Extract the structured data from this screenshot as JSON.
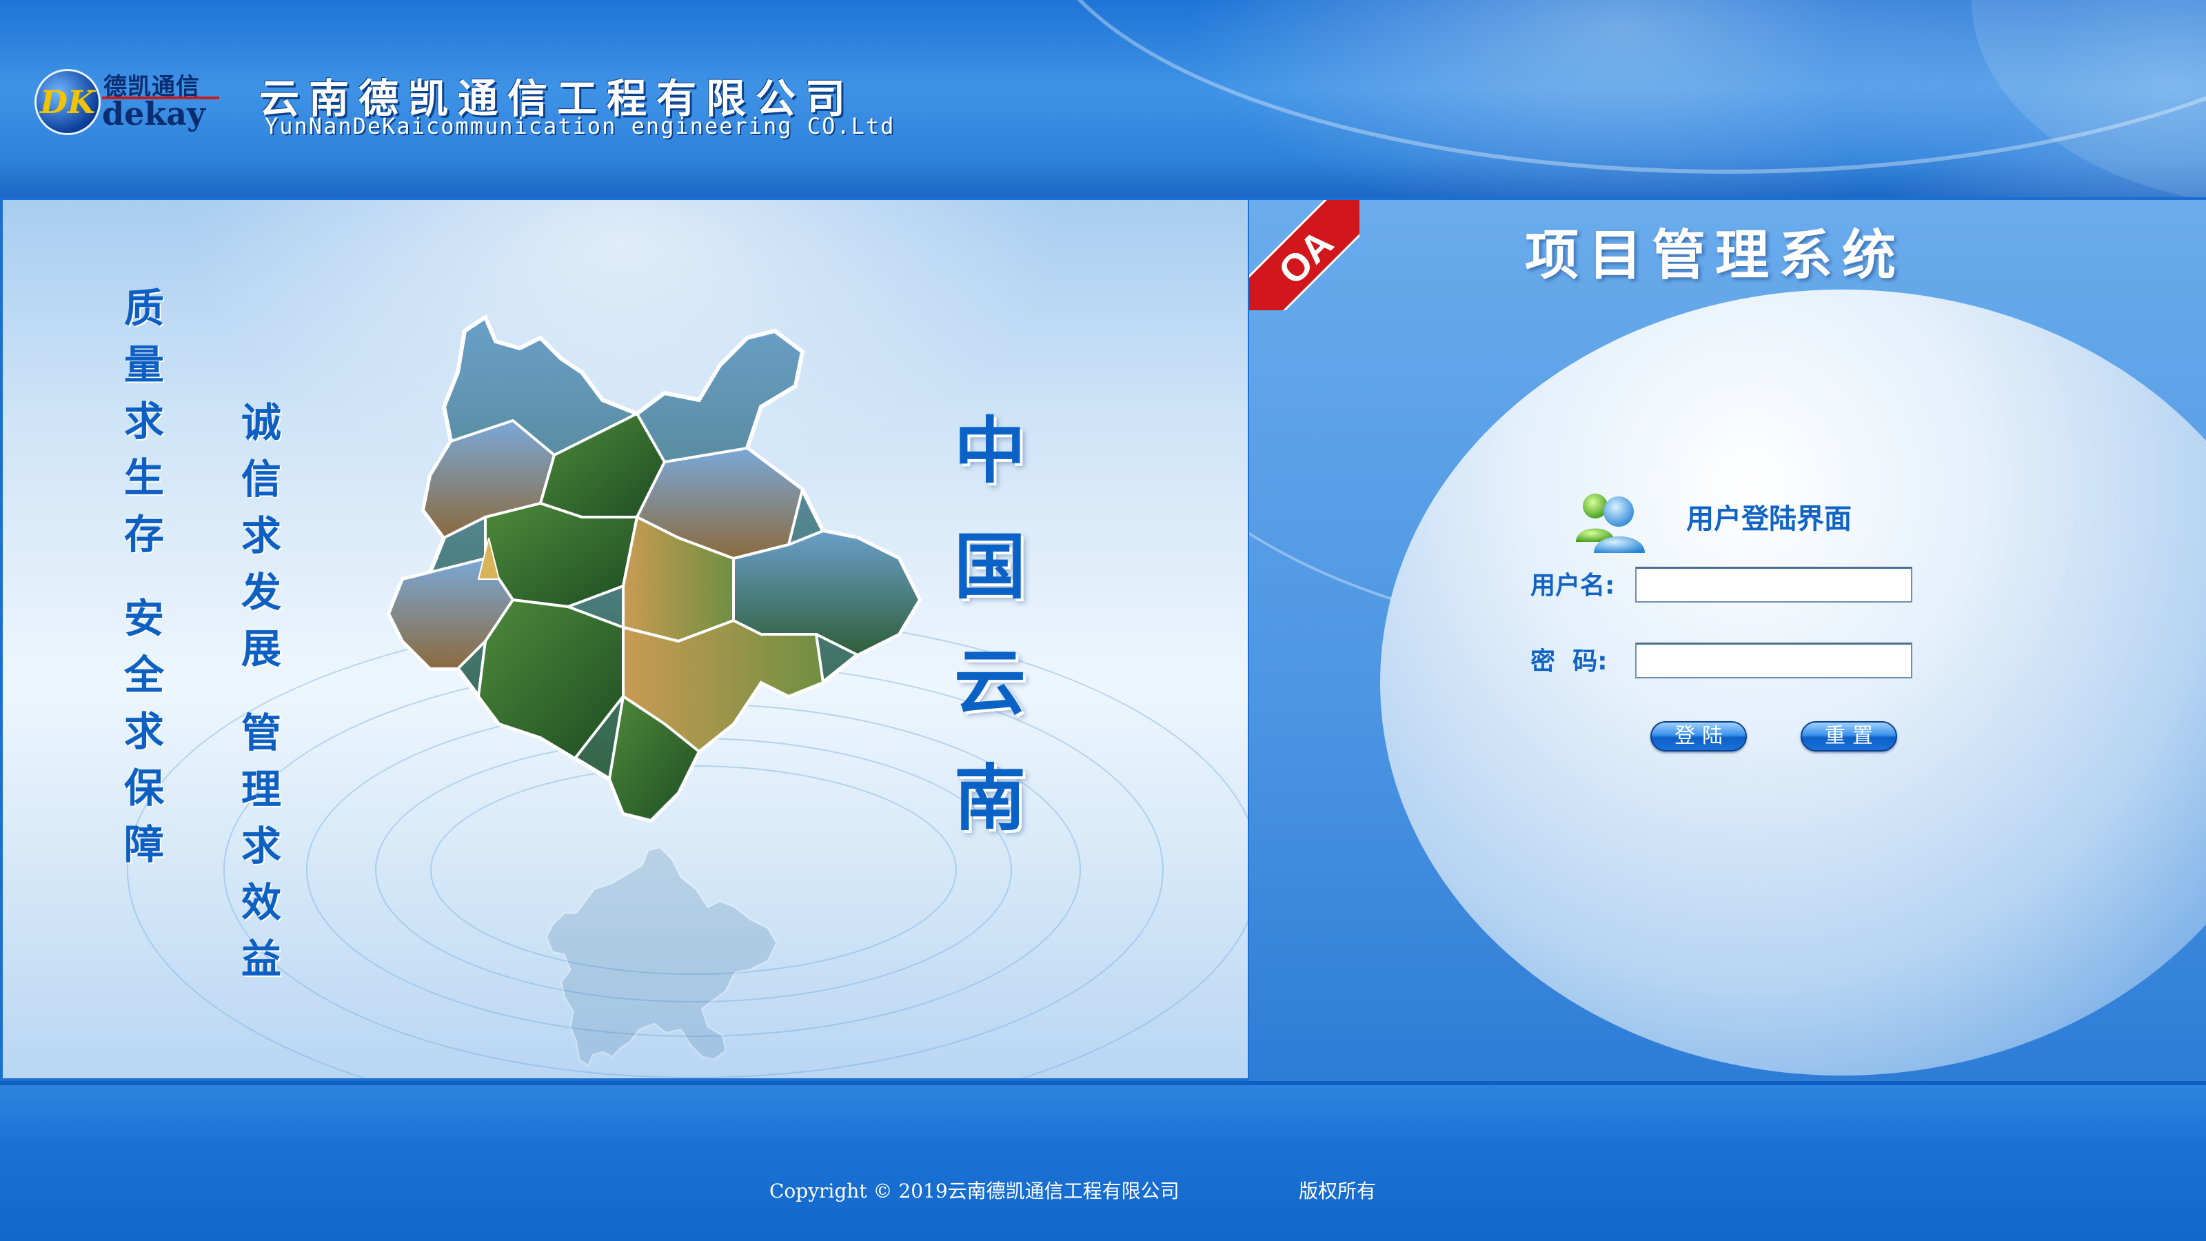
{
  "header": {
    "logo_cn": "德凯通信",
    "logo_en": "dekay",
    "logo_mark": "DK",
    "company_cn": "云南德凯通信工程有限公司",
    "company_en": "YunNanDeKaicommunication engineering CO.Ltd"
  },
  "banner": {
    "slogan_left": [
      "质",
      "量",
      "求",
      "生",
      "存",
      "",
      "安",
      "全",
      "求",
      "保",
      "障"
    ],
    "slogan_right": [
      "诚",
      "信",
      "求",
      "发",
      "展",
      "",
      "管",
      "理",
      "求",
      "效",
      "益"
    ],
    "title_vertical": [
      "中",
      "国",
      "云",
      "南"
    ]
  },
  "login": {
    "ribbon": "OA",
    "system_title": "项目管理系统",
    "panel_title": "用户登陆界面",
    "username_label": "用户名:",
    "username_value": "",
    "password_label": "密  码:",
    "password_value": "",
    "login_button": "登陆",
    "reset_button": "重置"
  },
  "footer": {
    "copyright": "Copyright © 2019云南德凯通信工程有限公司",
    "rights": "版权所有"
  },
  "colors": {
    "header_blue": "#2f82dc",
    "title_blue": "#0a62c6",
    "label_blue": "#1163c4",
    "ribbon_red": "#d2171c"
  },
  "icons": [
    "users-icon",
    "map-image"
  ]
}
